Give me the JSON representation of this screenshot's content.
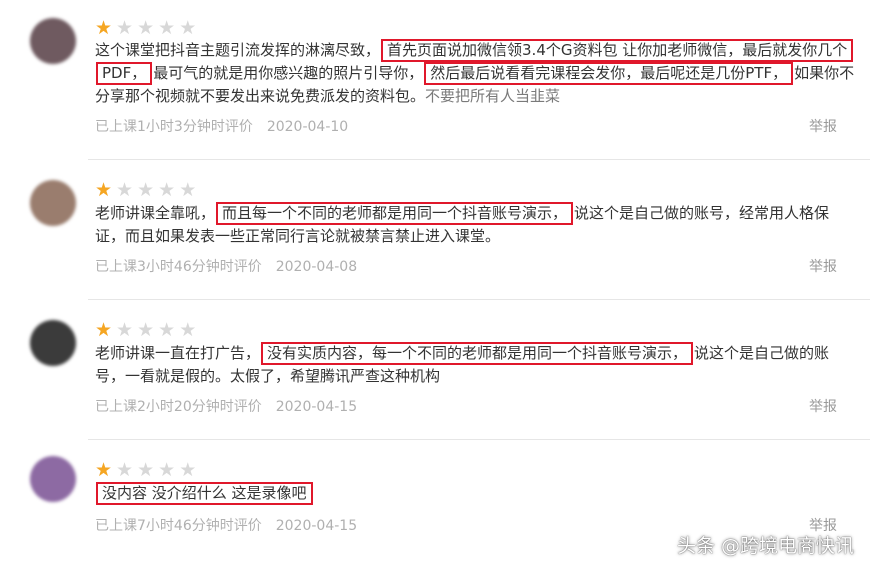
{
  "reviews": [
    {
      "rating": 1,
      "text_a": "这个课堂把抖音主题引流发挥的淋漓尽致，",
      "hl_1": "首先页面说加微信领3.4个G资料包 让你加老师微信，最后就发你几个",
      "hl_2": "PDF，",
      "text_b": "最可气的就是用你感兴趣的照片引导你，",
      "hl_3": "然后最后说看看完课程会发你，最后呢还是几份PTF，",
      "text_c": "如果你不分享那个视频就不要发出来说免费派发的资料包。",
      "text_d": "不要把所有人当韭菜",
      "meta": "已上课1小时3分钟时评价",
      "date": "2020-04-10",
      "report": "举报",
      "avatar_color": "#6f5a60"
    },
    {
      "rating": 1,
      "text_a": "老师讲课全靠吼，",
      "hl_1": "而且每一个不同的老师都是用同一个抖音账号演示，",
      "text_b": "说这个是自己做的账号，经常用人格保证，而且如果发表一些正常同行言论就被禁言禁止进入课堂。",
      "meta": "已上课3小时46分钟时评价",
      "date": "2020-04-08",
      "report": "举报",
      "avatar_color": "#9a7d6e"
    },
    {
      "rating": 1,
      "text_a": "老师讲课一直在打广告，",
      "hl_1": "没有实质内容，每一个不同的老师都是用同一个抖音账号演示，",
      "text_b": "说这个是自己做的账号，一看就是假的。太假了，希望腾讯严查这种机构",
      "meta": "已上课2小时20分钟时评价",
      "date": "2020-04-15",
      "report": "举报",
      "avatar_color": "#3b3b3b"
    },
    {
      "rating": 1,
      "hl_1": "没内容 没介绍什么 这是录像吧",
      "meta": "已上课7小时46分钟时评价",
      "date": "2020-04-15",
      "report": "举报",
      "avatar_color": "#8d6aa3"
    }
  ],
  "watermark": "头条 @跨境电商快讯",
  "colors": {
    "star_on": "#f5a623",
    "star_off": "#d8d8d8",
    "highlight_box": "#e0182b"
  }
}
